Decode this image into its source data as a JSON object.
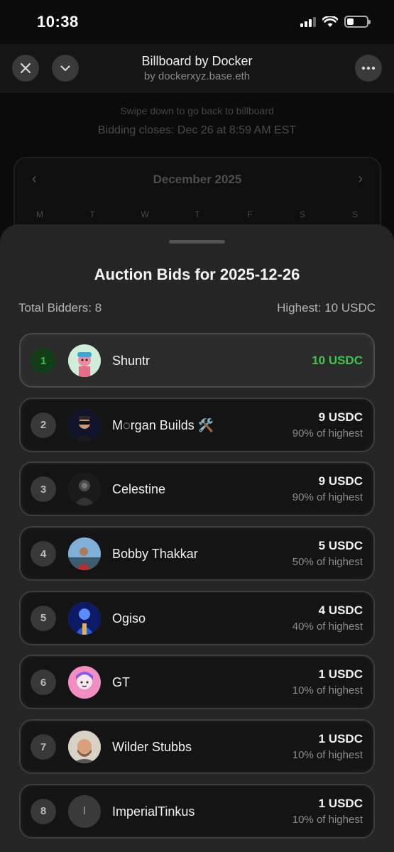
{
  "status": {
    "time": "10:38"
  },
  "header": {
    "title": "Billboard by Docker",
    "subtitle": "by dockerxyz.base.eth"
  },
  "background": {
    "hint": "Swipe down to go back to billboard",
    "closes": "Bidding closes: Dec 26 at 8:59 AM EST",
    "calendar": {
      "month": "December 2025",
      "weekdays": [
        "M",
        "T",
        "W",
        "T",
        "F",
        "S",
        "S"
      ]
    }
  },
  "sheet": {
    "title": "Auction Bids for 2025-12-26",
    "total_bidders": "Total Bidders: 8",
    "highest": "Highest: 10 USDC"
  },
  "bids": [
    {
      "rank": "1",
      "name": "Shuntr",
      "amount": "10 USDC",
      "pct": ""
    },
    {
      "rank": "2",
      "name": "M◌rgan Builds 🛠️",
      "amount": "9 USDC",
      "pct": "90% of highest"
    },
    {
      "rank": "3",
      "name": "Celestine",
      "amount": "9 USDC",
      "pct": "90% of highest"
    },
    {
      "rank": "4",
      "name": "Bobby Thakkar",
      "amount": "5 USDC",
      "pct": "50% of highest"
    },
    {
      "rank": "5",
      "name": "Ogiso",
      "amount": "4 USDC",
      "pct": "40% of highest"
    },
    {
      "rank": "6",
      "name": "GT",
      "amount": "1 USDC",
      "pct": "10% of highest"
    },
    {
      "rank": "7",
      "name": "Wilder Stubbs",
      "amount": "1 USDC",
      "pct": "10% of highest"
    },
    {
      "rank": "8",
      "name": "ImperialTinkus",
      "amount": "1 USDC",
      "pct": "10% of highest",
      "avatar_initial": "I"
    }
  ],
  "colors": {
    "accent_green": "#3ec74a",
    "sheet_bg": "#252525",
    "row_bg": "#141414"
  }
}
